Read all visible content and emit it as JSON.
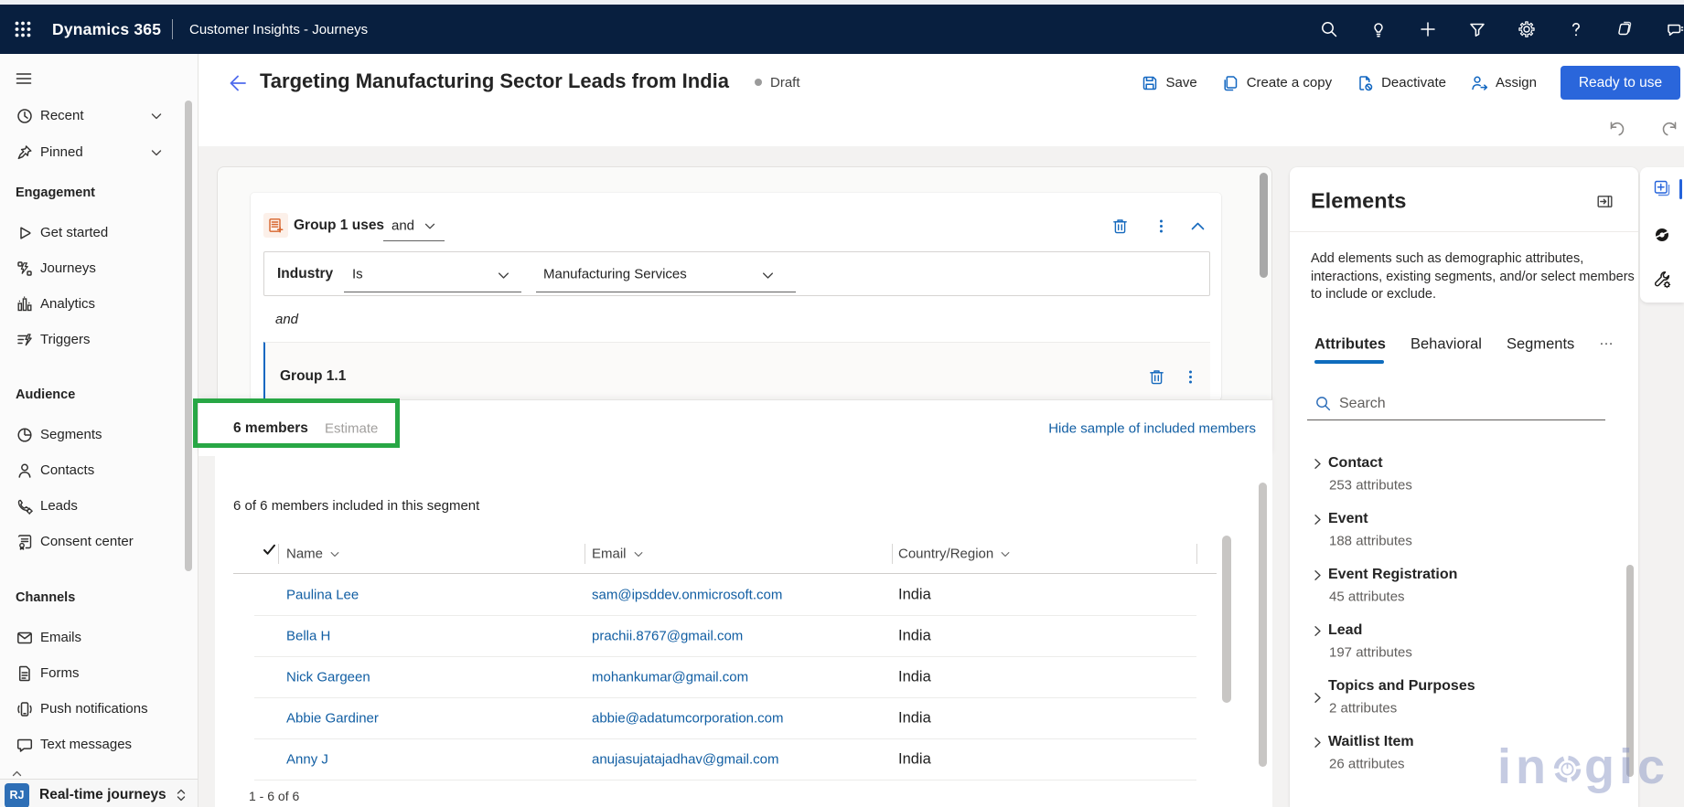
{
  "colors": {
    "top_bar": "#081f3f",
    "accent_blue": "#0f6cbd",
    "command_icon_blue": "#1267c1",
    "primary_button": "#2a66db",
    "link_blue": "#115ea3",
    "annotation_green": "#28a745",
    "subgroup_border_blue": "#1267c1",
    "group_icon_orange": "#d7642c"
  },
  "top_bar": {
    "brand": "Dynamics 365",
    "app_name": "Customer Insights - Journeys",
    "icons": [
      "waffle-icon",
      "search-icon",
      "lightbulb-icon",
      "add-icon",
      "filter-icon",
      "settings-icon",
      "help-icon",
      "copilot-icon",
      "feedback-icon"
    ]
  },
  "sidebar": {
    "collapsible": [
      {
        "label": "Recent",
        "icon": "clock-icon"
      },
      {
        "label": "Pinned",
        "icon": "pin-icon"
      }
    ],
    "sections": [
      {
        "title": "Engagement",
        "items": [
          {
            "label": "Get started",
            "icon": "play-icon"
          },
          {
            "label": "Journeys",
            "icon": "journeys-icon"
          },
          {
            "label": "Analytics",
            "icon": "analytics-icon"
          },
          {
            "label": "Triggers",
            "icon": "triggers-icon"
          }
        ]
      },
      {
        "title": "Audience",
        "items": [
          {
            "label": "Segments",
            "icon": "pie-icon"
          },
          {
            "label": "Contacts",
            "icon": "person-icon"
          },
          {
            "label": "Leads",
            "icon": "phone-gear-icon"
          },
          {
            "label": "Consent center",
            "icon": "certificate-icon"
          }
        ]
      },
      {
        "title": "Channels",
        "items": [
          {
            "label": "Emails",
            "icon": "envelope-icon"
          },
          {
            "label": "Forms",
            "icon": "document-icon"
          },
          {
            "label": "Push notifications",
            "icon": "mobile-icon"
          },
          {
            "label": "Text messages",
            "icon": "chat-icon"
          }
        ]
      }
    ],
    "area_switcher": {
      "abbr": "RJ",
      "label": "Real-time journeys"
    }
  },
  "header": {
    "title": "Targeting Manufacturing Sector Leads from India",
    "status": "Draft",
    "toolbar": {
      "save": "Save",
      "create_copy": "Create a copy",
      "deactivate": "Deactivate",
      "assign": "Assign",
      "primary": "Ready to use"
    }
  },
  "builder": {
    "group_title": "Group 1 uses",
    "group_operator": "and",
    "condition": {
      "field": "Industry",
      "operator": "Is",
      "value": "Manufacturing Services"
    },
    "connector": "and",
    "subgroup_title": "Group 1.1"
  },
  "members_bar": {
    "count_label": "6 members",
    "estimate_label": "Estimate",
    "hide_link": "Hide sample of included members"
  },
  "members": {
    "summary": "6 of 6 members included in this segment",
    "columns": [
      "Name",
      "Email",
      "Country/Region"
    ],
    "rows": [
      {
        "name": "Paulina Lee",
        "email": "sam@ipsddev.onmicrosoft.com",
        "country": "India"
      },
      {
        "name": "Bella H",
        "email": "prachii.8767@gmail.com",
        "country": "India"
      },
      {
        "name": "Nick Gargeen",
        "email": "mohankumar@gmail.com",
        "country": "India"
      },
      {
        "name": "Abbie Gardiner",
        "email": "abbie@adatumcorporation.com",
        "country": "India"
      },
      {
        "name": "Anny J",
        "email": "anujasujatajadhav@gmail.com",
        "country": "India"
      }
    ],
    "pagination": "1 - 6 of 6"
  },
  "elements_panel": {
    "title": "Elements",
    "description": "Add elements such as demographic attributes, interactions, existing segments, and/or select members to include or exclude.",
    "tabs": [
      "Attributes",
      "Behavioral",
      "Segments"
    ],
    "active_tab": "Attributes",
    "overflow_tab": "…",
    "search_placeholder": "Search",
    "entities": [
      {
        "name": "Contact",
        "count": "253 attributes"
      },
      {
        "name": "Event",
        "count": "188 attributes"
      },
      {
        "name": "Event Registration",
        "count": "45 attributes"
      },
      {
        "name": "Lead",
        "count": "197 attributes"
      },
      {
        "name": "Topics and Purposes",
        "count": "2 attributes"
      },
      {
        "name": "Waitlist Item",
        "count": "26 attributes"
      }
    ]
  },
  "watermark": {
    "left": "in",
    "right": "gic"
  }
}
